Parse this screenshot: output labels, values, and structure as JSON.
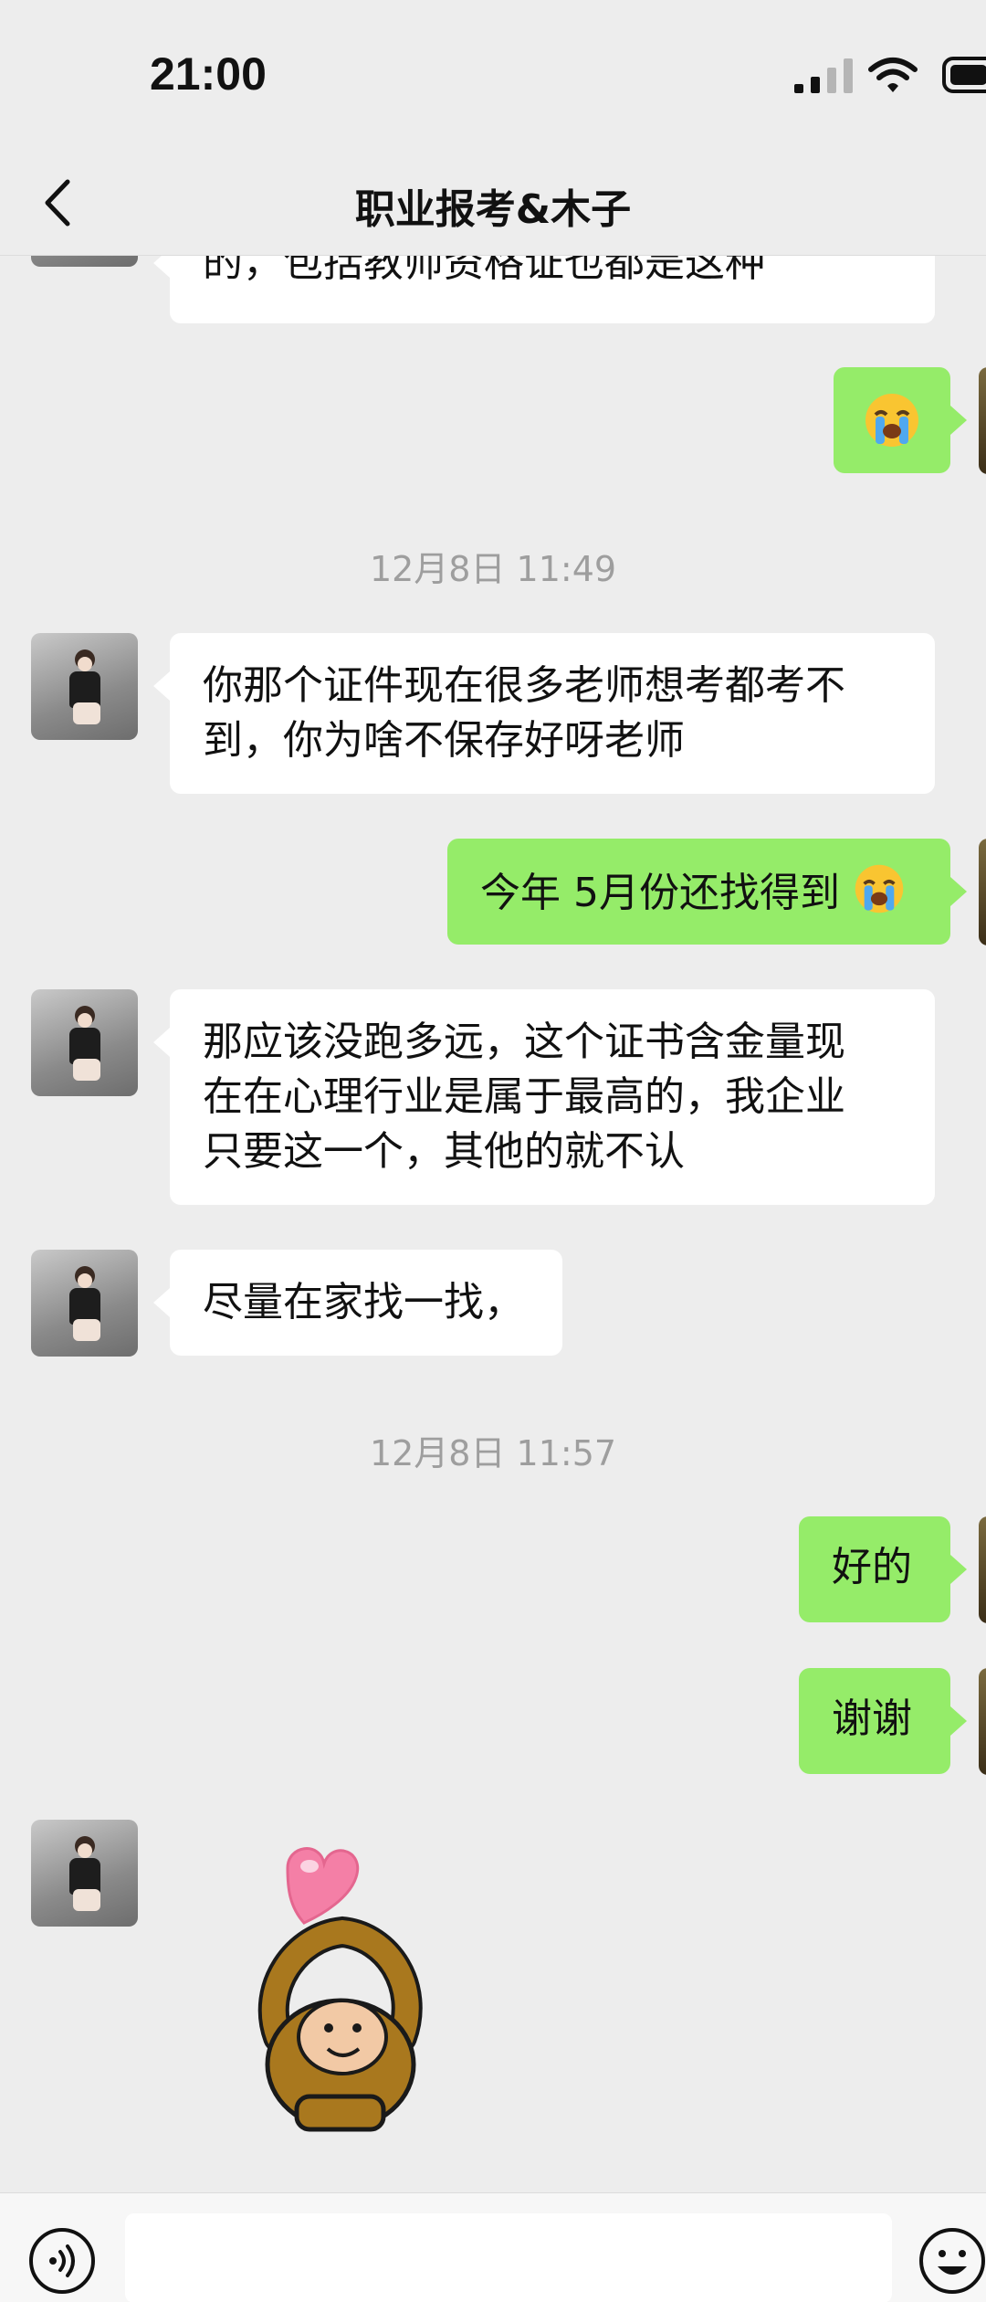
{
  "status_bar": {
    "time": "21:00"
  },
  "nav": {
    "title": "职业报考&木子"
  },
  "messages": [
    {
      "side": "in",
      "text": "的，包括教师资格证也都是这种"
    },
    {
      "side": "out",
      "emoji": "loudly-crying-face-emoji"
    },
    {
      "timestamp": "12月8日 11:49"
    },
    {
      "side": "in",
      "lines": [
        "你那个证件现在很多老师想考都考不",
        "到，你为啥不保存好呀老师"
      ]
    },
    {
      "side": "out",
      "text": "今年 5月份还找得到",
      "emoji": "loudly-crying-face-emoji"
    },
    {
      "side": "in",
      "lines": [
        "那应该没跑多远，这个证书含金量现",
        "在在心理行业是属于最高的，我企业",
        "只要这一个，其他的就不认"
      ]
    },
    {
      "side": "in",
      "text": "尽量在家找一找，"
    },
    {
      "timestamp": "12月8日 11:57"
    },
    {
      "side": "out",
      "text": "好的"
    },
    {
      "side": "out",
      "text": "谢谢"
    },
    {
      "side": "in",
      "sticker": "monkey-heart-sticker"
    }
  ],
  "colors": {
    "background": "#ededed",
    "outgoing_bubble": "#95ec69",
    "incoming_bubble": "#ffffff",
    "timestamp_text": "#9e9e9e"
  },
  "input_bar": {
    "value": ""
  }
}
